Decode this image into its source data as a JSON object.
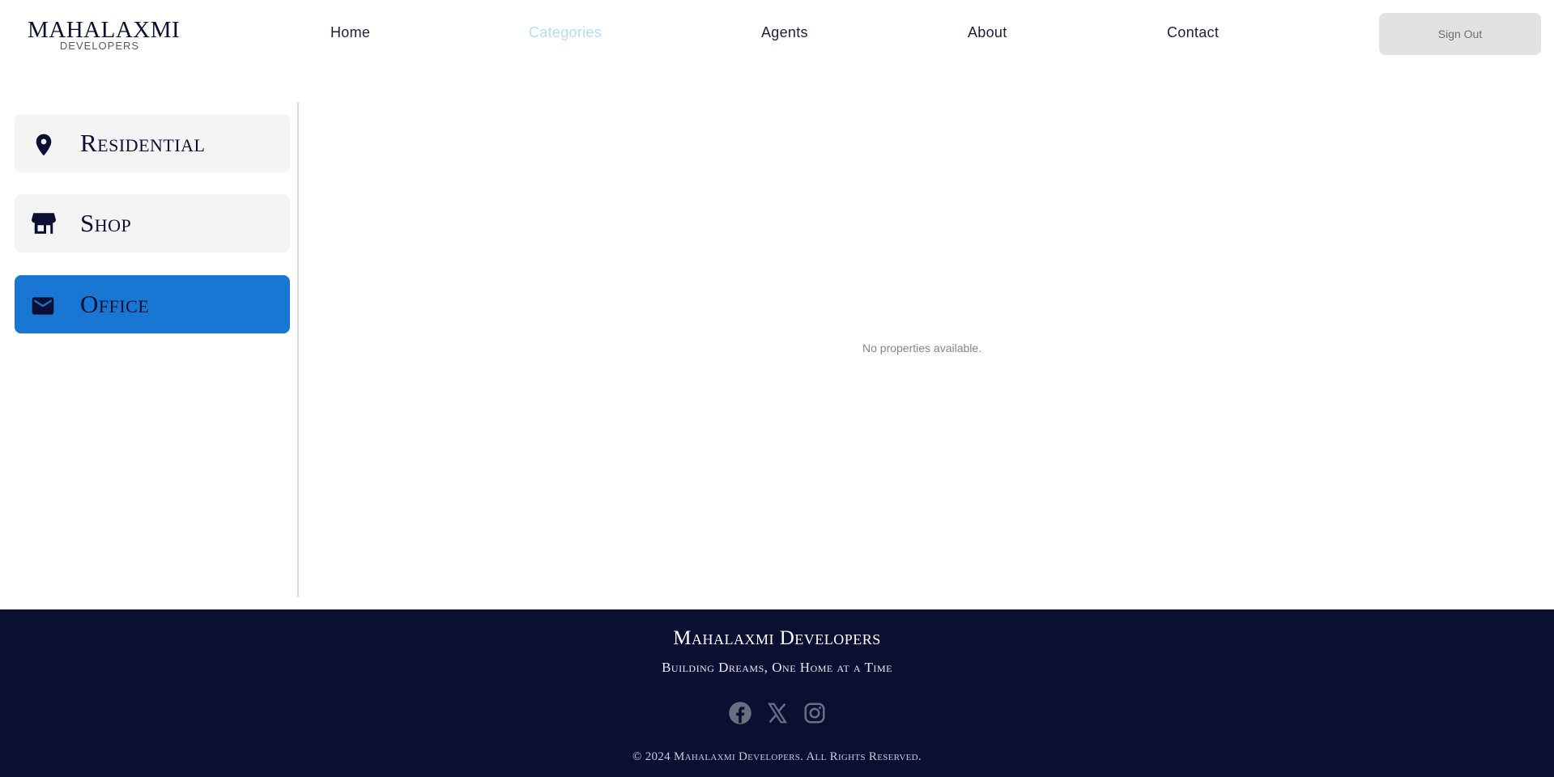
{
  "brand": {
    "name": "MAHALAXMI",
    "sub": "DEVELOPERS"
  },
  "nav": {
    "items": [
      {
        "label": "Home",
        "active": false
      },
      {
        "label": "Categories",
        "active": true
      },
      {
        "label": "Agents",
        "active": false
      },
      {
        "label": "About",
        "active": false
      },
      {
        "label": "Contact",
        "active": false
      }
    ],
    "signout_label": "Sign Out"
  },
  "categories": [
    {
      "label": "Residential",
      "icon": "location-pin-icon",
      "selected": false
    },
    {
      "label": "Shop",
      "icon": "store-icon",
      "selected": false
    },
    {
      "label": "Office",
      "icon": "mail-icon",
      "selected": true
    }
  ],
  "main": {
    "empty_message": "No properties available."
  },
  "footer": {
    "title": "Mahalaxmi Developers",
    "tagline": "Building Dreams, One Home at a Time",
    "socials": [
      "facebook-icon",
      "x-icon",
      "instagram-icon"
    ],
    "copyright": "© 2024 Mahalaxmi Developers. All Rights Reserved."
  },
  "colors": {
    "navy": "#0b1033",
    "accent_blue": "#1976d2",
    "active_nav": "#b9dcf3",
    "card_bg": "#f4f4f4"
  }
}
